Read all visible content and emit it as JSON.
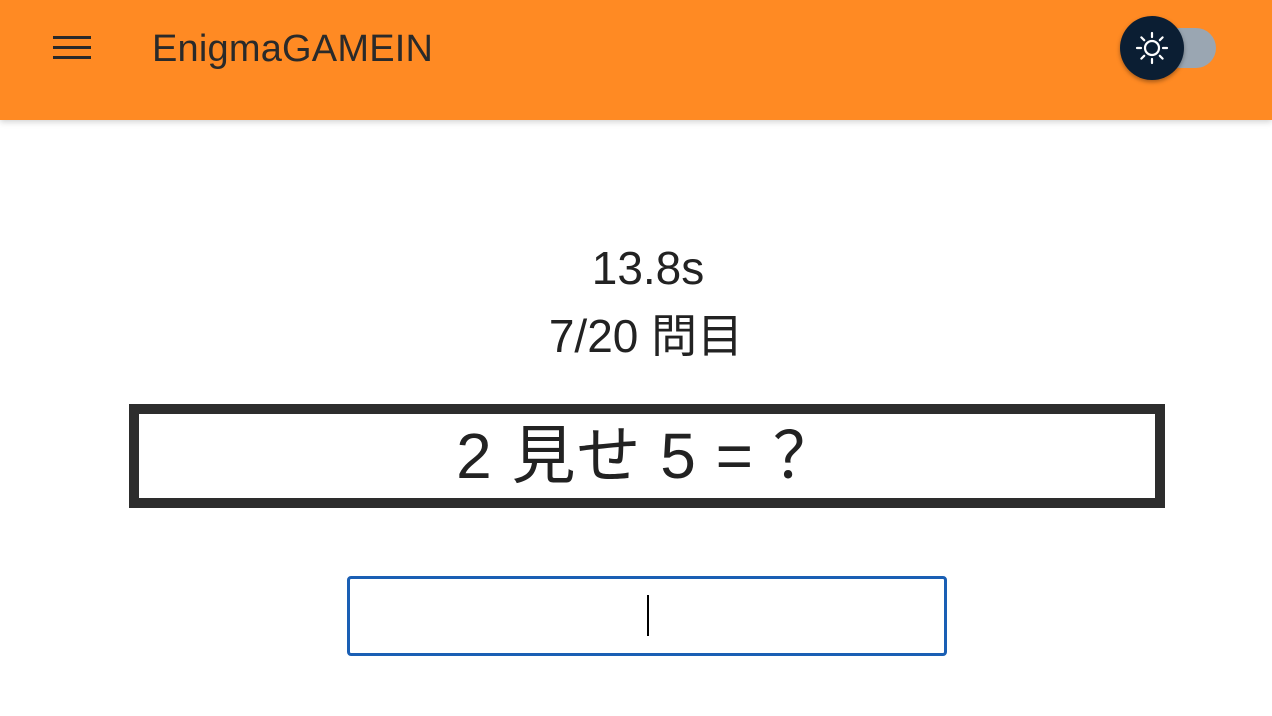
{
  "header": {
    "title": "EnigmaGAMEIN",
    "background_color": "#ff8a23",
    "menu_icon": "hamburger-menu-icon",
    "theme_toggle": {
      "icon": "sun-icon",
      "state": "light",
      "thumb_color": "#0b1e33",
      "track_color": "#9aa6b2"
    }
  },
  "game": {
    "timer": "13.8s",
    "progress": "7/20 問目",
    "question": "2 見せ 5 = ？",
    "answer": {
      "value": "",
      "placeholder": "",
      "border_color": "#1a5fb4"
    }
  }
}
